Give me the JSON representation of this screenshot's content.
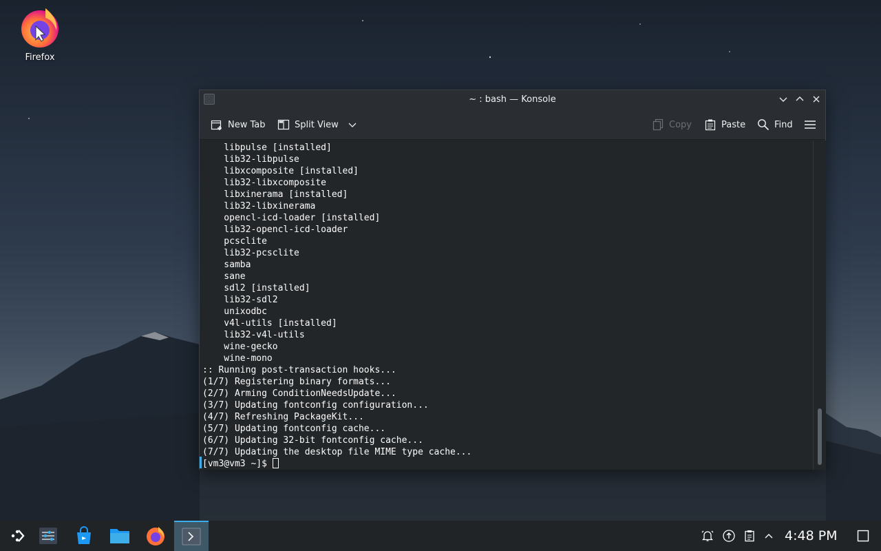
{
  "desktop": {
    "icons": [
      {
        "label": "Firefox",
        "icon": "firefox-icon"
      }
    ]
  },
  "window": {
    "title": "~ : bash — Konsole",
    "toolbar": {
      "new_tab": "New Tab",
      "split_view": "Split View",
      "copy": "Copy",
      "paste": "Paste",
      "find": "Find"
    },
    "terminal": {
      "lines": [
        "    libpulse [installed]",
        "    lib32-libpulse",
        "    libxcomposite [installed]",
        "    lib32-libxcomposite",
        "    libxinerama [installed]",
        "    lib32-libxinerama",
        "    opencl-icd-loader [installed]",
        "    lib32-opencl-icd-loader",
        "    pcsclite",
        "    lib32-pcsclite",
        "    samba",
        "    sane",
        "    sdl2 [installed]",
        "    lib32-sdl2",
        "    unixodbc",
        "    v4l-utils [installed]",
        "    lib32-v4l-utils",
        "    wine-gecko",
        "    wine-mono",
        ":: Running post-transaction hooks...",
        "(1/7) Registering binary formats...",
        "(2/7) Arming ConditionNeedsUpdate...",
        "(3/7) Updating fontconfig configuration...",
        "(4/7) Refreshing PackageKit...",
        "(5/7) Updating fontconfig cache...",
        "(6/7) Updating 32-bit fontconfig cache...",
        "(7/7) Updating the desktop file MIME type cache..."
      ],
      "prompt": "[vm3@vm3 ~]$ "
    }
  },
  "taskbar": {
    "clock": "4:48 PM",
    "colors": {
      "accent": "#3daee9",
      "active_bg": "#3e5868"
    }
  }
}
